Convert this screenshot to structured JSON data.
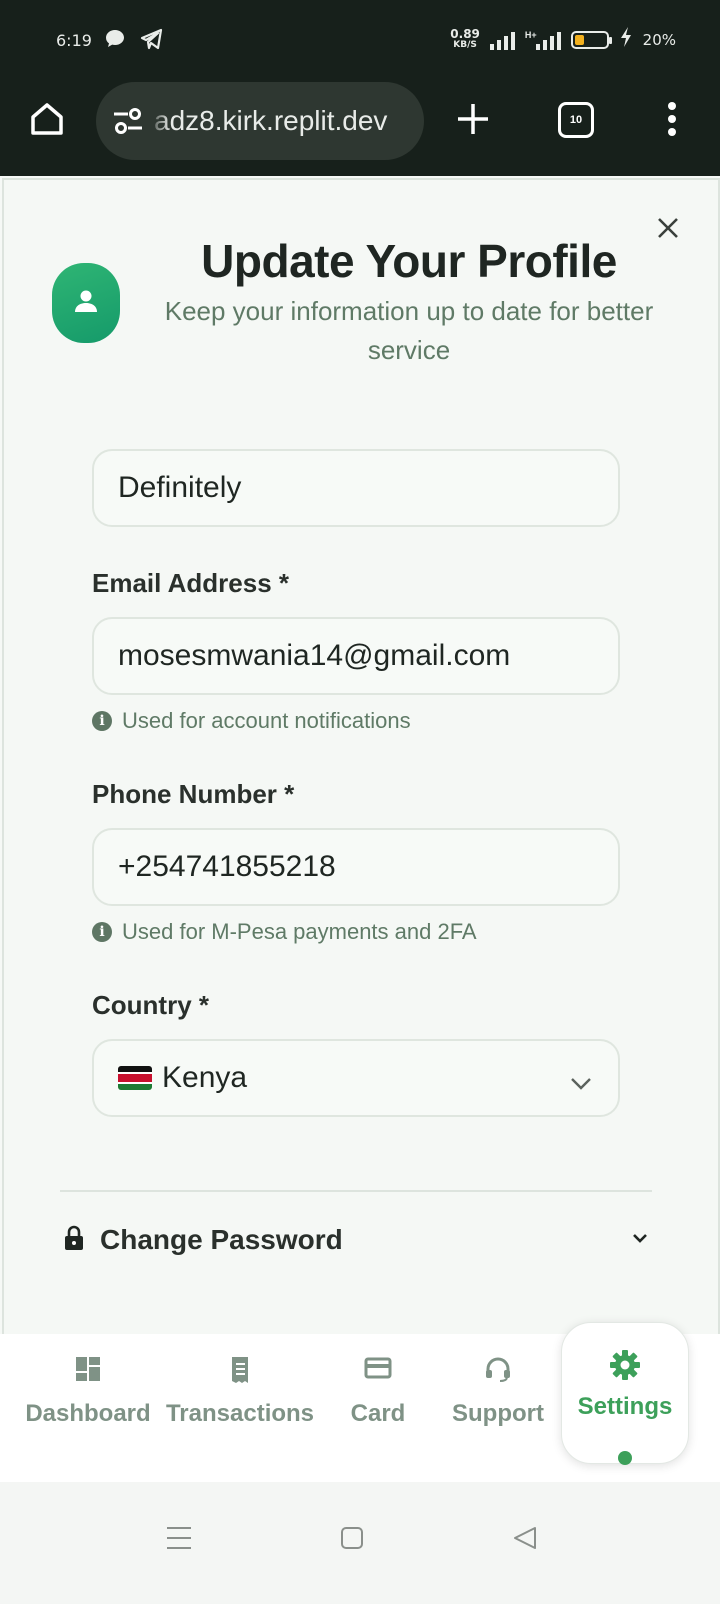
{
  "status_bar": {
    "time": "6:19",
    "net_speed_value": "0.89",
    "net_speed_unit": "KB/S",
    "network_type": "H+",
    "battery_percent": "20%",
    "battery_level": 0.2,
    "battery_color": "#f2b01e",
    "notification_icons": [
      "chat-bubble-icon",
      "telegram-icon"
    ]
  },
  "browser": {
    "url": "adz8.kirk.replit.dev",
    "tab_count": "10"
  },
  "modal": {
    "title": "Update Your Profile",
    "subtitle": "Keep your information up to date for better service",
    "accent_color": "#22a86e",
    "name_value": "Definitely",
    "email": {
      "label": "Email Address *",
      "value": "mosesmwania14@gmail.com",
      "hint": "Used for account notifications"
    },
    "phone": {
      "label": "Phone Number *",
      "value": "+254741855218",
      "hint": "Used for M-Pesa payments and 2FA"
    },
    "country": {
      "label": "Country *",
      "selected": "Kenya",
      "flag": "kenya-flag"
    },
    "change_password_label": "Change Password"
  },
  "bottom_nav": {
    "items": [
      {
        "label": "Dashboard",
        "icon": "dashboard-icon"
      },
      {
        "label": "Transactions",
        "icon": "receipt-icon"
      },
      {
        "label": "Card",
        "icon": "credit-card-icon"
      },
      {
        "label": "Support",
        "icon": "headset-icon"
      },
      {
        "label": "Settings",
        "icon": "gear-icon"
      }
    ],
    "active": "Settings",
    "active_color": "#3da05a",
    "inactive_color": "#7f9286"
  }
}
